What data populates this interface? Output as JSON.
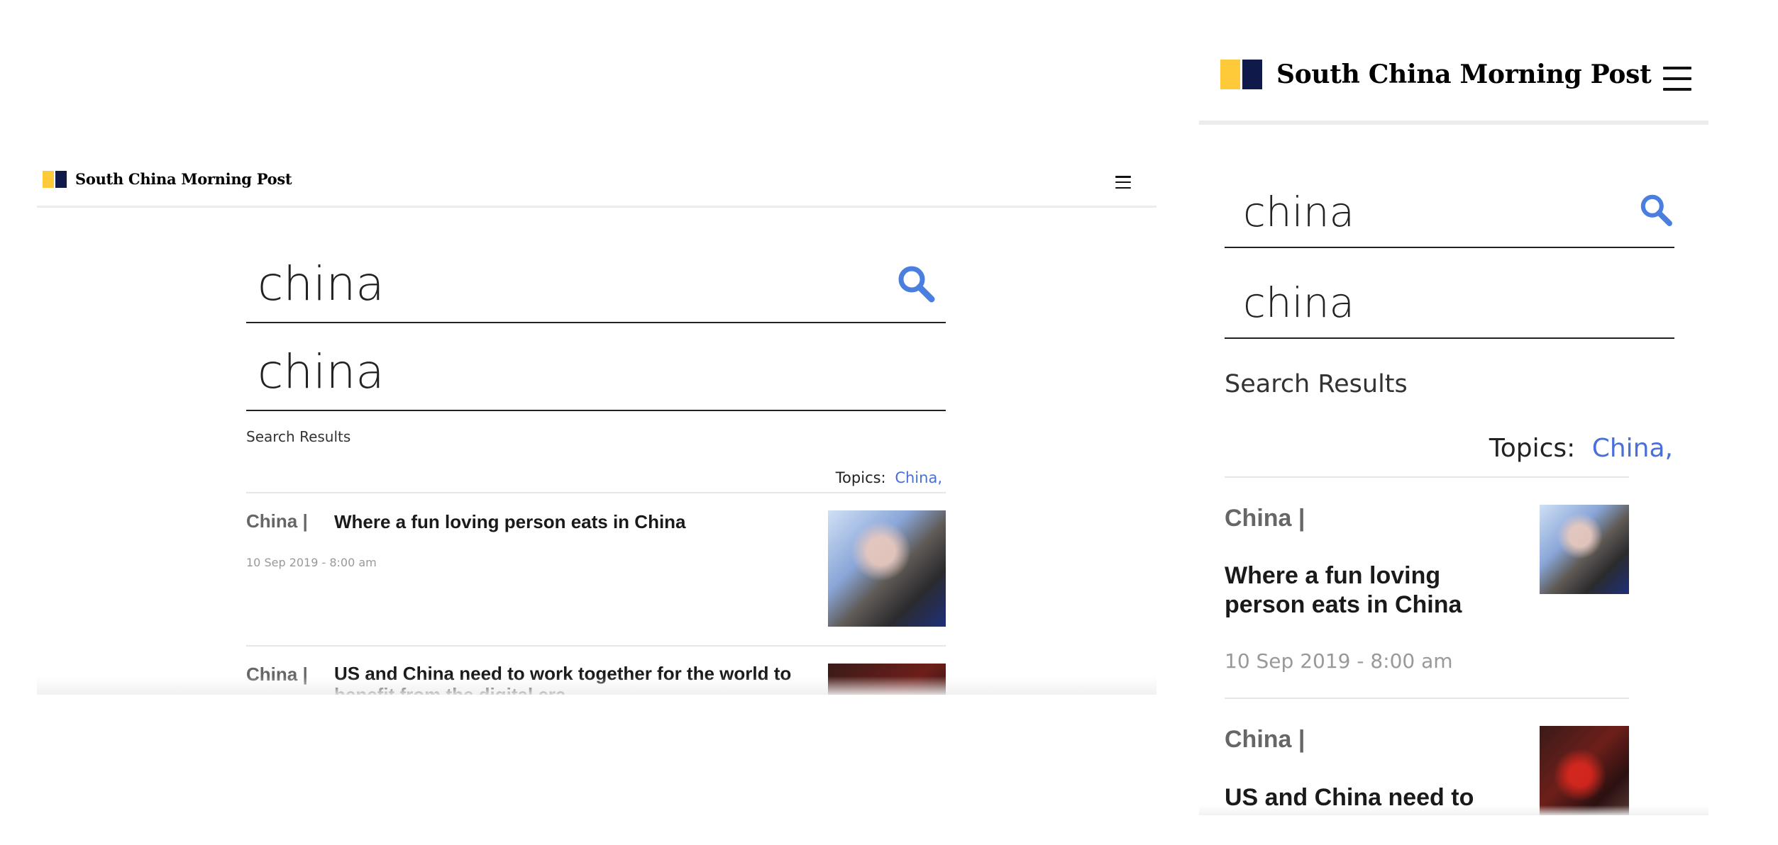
{
  "header": {
    "brand": "South China Morning Post",
    "menu_icon": "hamburger-menu-icon"
  },
  "search": {
    "query": "china",
    "secondary_query": "china",
    "icon": "search-icon",
    "icon_color": "#4A7FE0"
  },
  "results": {
    "label": "Search Results",
    "topics_label": "Topics:",
    "topics": [
      "China,"
    ]
  },
  "articles": [
    {
      "category": "China |",
      "title": "Where a fun loving person eats in China",
      "date": "10 Sep 2019 - 8:00 am"
    },
    {
      "category": "China |",
      "title": "US and China need to work together for the world to benefit from the digital era",
      "title_mobile": "US and China need to work"
    }
  ],
  "colors": {
    "brand_yellow": "#FFCA3A",
    "brand_navy": "#0F1A4A",
    "topic_link": "#4A6FD8"
  }
}
